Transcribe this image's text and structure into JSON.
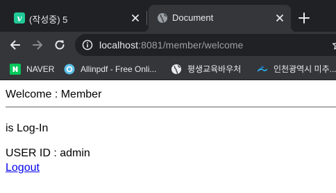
{
  "tabs": [
    {
      "title": "(작성중) 5",
      "favicon": "velog-v-icon",
      "active": false
    },
    {
      "title": "Document",
      "favicon": "globe-icon",
      "active": true
    }
  ],
  "toolbar": {
    "url_host": "localhost",
    "url_path": ":8081/member/welcome"
  },
  "bookmarks": [
    {
      "label": "NAVER",
      "icon": "naver-n-icon"
    },
    {
      "label": "Allinpdf - Free Onli...",
      "icon": "allinpdf-icon"
    },
    {
      "label": "평생교육바우처",
      "icon": "globe-icon"
    },
    {
      "label": "인천광역시 미추...",
      "icon": "incheon-logo-icon"
    }
  ],
  "page": {
    "heading": "Welcome : Member",
    "status": "is Log-In",
    "user_id_line": "USER ID : admin",
    "logout_link": "Logout"
  },
  "colors": {
    "tab_strip": "#202124",
    "toolbar": "#35363a",
    "link": "#0000ee",
    "velog_green": "#20c997",
    "naver_green": "#03c75a"
  }
}
